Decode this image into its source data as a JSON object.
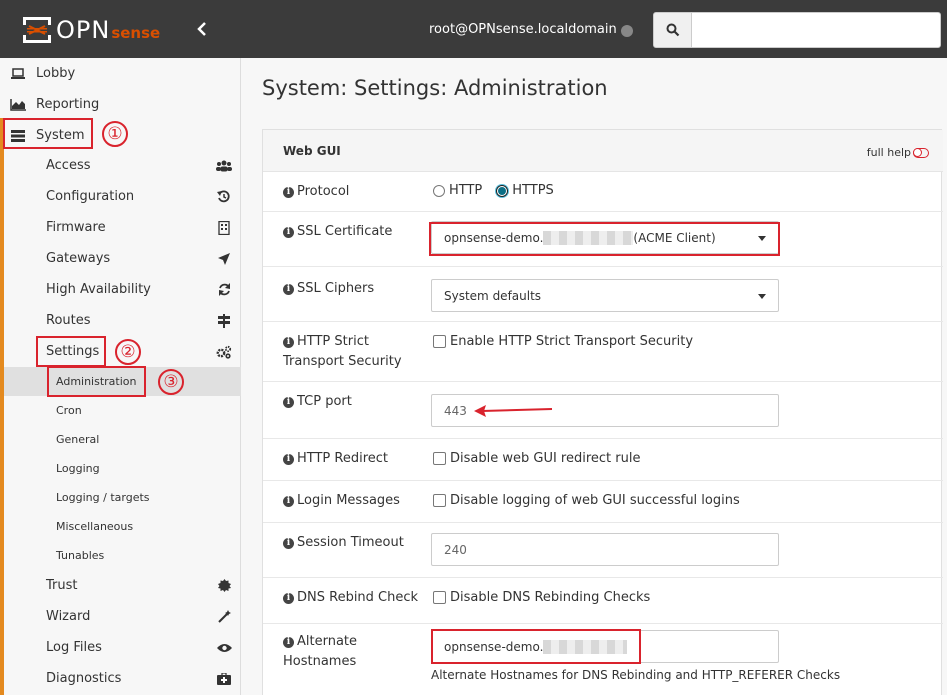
{
  "header": {
    "logo_opn": "OPN",
    "logo_sense": "sense",
    "user": "root@OPNsense.localdomain",
    "search_placeholder": ""
  },
  "sidebar": {
    "top_items": [
      {
        "label": "Lobby",
        "icon": "laptop-icon"
      },
      {
        "label": "Reporting",
        "icon": "area-chart-icon"
      },
      {
        "label": "System",
        "icon": "server-icon"
      }
    ],
    "system_items": [
      {
        "label": "Access",
        "icon": "users-icon"
      },
      {
        "label": "Configuration",
        "icon": "history-icon"
      },
      {
        "label": "Firmware",
        "icon": "building-icon"
      },
      {
        "label": "Gateways",
        "icon": "location-arrow-icon"
      },
      {
        "label": "High Availability",
        "icon": "refresh-icon"
      },
      {
        "label": "Routes",
        "icon": "map-signs-icon"
      },
      {
        "label": "Settings",
        "icon": "cogs-icon"
      }
    ],
    "settings_items": [
      {
        "label": "Administration"
      },
      {
        "label": "Cron"
      },
      {
        "label": "General"
      },
      {
        "label": "Logging"
      },
      {
        "label": "Logging / targets"
      },
      {
        "label": "Miscellaneous"
      },
      {
        "label": "Tunables"
      }
    ],
    "more_items": [
      {
        "label": "Trust",
        "icon": "certificate-icon"
      },
      {
        "label": "Wizard",
        "icon": "magic-icon"
      },
      {
        "label": "Log Files",
        "icon": "eye-icon"
      },
      {
        "label": "Diagnostics",
        "icon": "medkit-icon"
      }
    ]
  },
  "annotations": [
    "①",
    "②",
    "③"
  ],
  "main": {
    "title": "System: Settings: Administration",
    "section_title": "Web GUI",
    "full_help": "full help",
    "protocol": {
      "label": "Protocol",
      "options": [
        "HTTP",
        "HTTPS"
      ],
      "selected": "HTTPS"
    },
    "ssl_certificate": {
      "label": "SSL Certificate",
      "value_prefix": "opnsense-demo.",
      "value_suffix": "(ACME Client)"
    },
    "ssl_ciphers": {
      "label": "SSL Ciphers",
      "value": "System defaults"
    },
    "hsts": {
      "label_line1": "HTTP Strict",
      "label_line2": "Transport Security",
      "checkbox": "Enable HTTP Strict Transport Security"
    },
    "tcp_port": {
      "label": "TCP port",
      "placeholder": "443"
    },
    "http_redirect": {
      "label": "HTTP Redirect",
      "checkbox": "Disable web GUI redirect rule"
    },
    "login_messages": {
      "label": "Login Messages",
      "checkbox": "Disable logging of web GUI successful logins"
    },
    "session_timeout": {
      "label": "Session Timeout",
      "placeholder": "240"
    },
    "dns_rebind": {
      "label": "DNS Rebind Check",
      "checkbox": "Disable DNS Rebinding Checks"
    },
    "alt_hostnames": {
      "label_line1": "Alternate",
      "label_line2": "Hostnames",
      "value_prefix": "opnsense-demo.",
      "help": "Alternate Hostnames for DNS Rebinding and HTTP_REFERER Checks"
    }
  },
  "colors": {
    "accent": "#e48a1f",
    "annotation": "#d9232d",
    "topbar": "#3b3b3b"
  }
}
